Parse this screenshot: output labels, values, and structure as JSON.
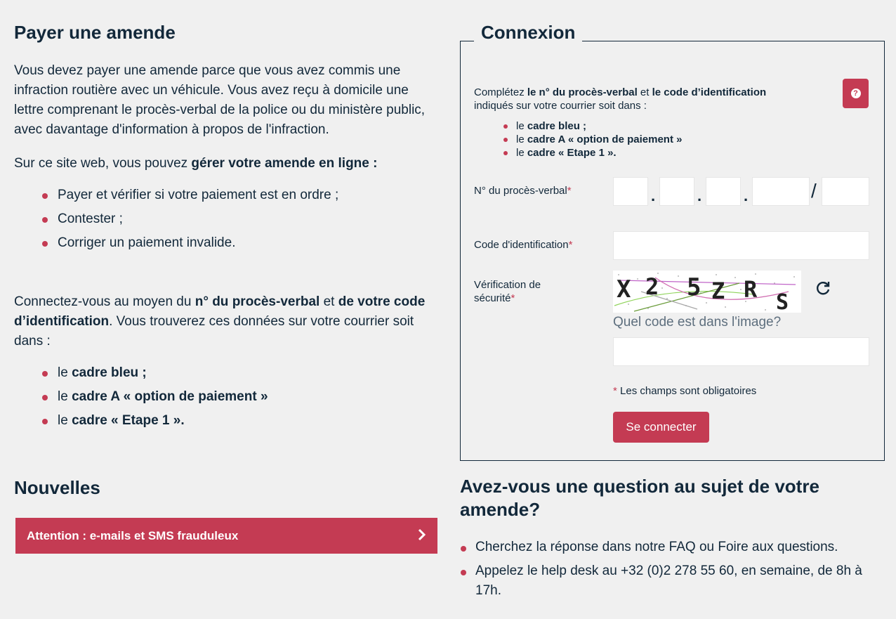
{
  "left": {
    "heading": "Payer une amende",
    "intro": "Vous devez payer une amende parce que vous avez commis une infraction routière avec un véhicule. Vous avez reçu à domicile une lettre comprenant le procès-verbal de la police ou du ministère public, avec davantage d'information à propos de l'infraction.",
    "site_prefix": "Sur ce site web, vous pouvez ",
    "site_bold": "gérer votre amende en ligne :",
    "actions": [
      "Payer et vérifier si votre paiement est en ordre ;",
      "Contester ;",
      "Corriger un paiement invalide."
    ],
    "connect": {
      "t1": "Connectez-vous au moyen du ",
      "b1": "n° du procès-verbal",
      "t2": " et ",
      "b2": "de votre code d’identification",
      "t3": ". Vous trouverez ces données sur votre courrier soit dans :"
    },
    "frames": [
      {
        "pre": "le ",
        "bold": "cadre bleu ;"
      },
      {
        "pre": "le ",
        "bold": "cadre A « option de paiement »"
      },
      {
        "pre": "le ",
        "bold": "cadre « Etape 1 »."
      }
    ]
  },
  "news": {
    "heading": "Nouvelles",
    "item": "Attention : e-mails et SMS frauduleux",
    "icon": "chevron-right-icon"
  },
  "login": {
    "legend": "Connexion",
    "help": {
      "t1": "Complétez ",
      "b1": "le n° du procès-verbal",
      "t2": " et ",
      "b2": "le code d’identification",
      "t3": " indiqués sur votre courrier soit dans :",
      "button_icon": "question-circle-icon"
    },
    "frames": [
      {
        "pre": "le ",
        "bold": "cadre bleu ;"
      },
      {
        "pre": "le ",
        "bold": "cadre A « option de paiement »"
      },
      {
        "pre": "le ",
        "bold": "cadre « Etape 1 »."
      }
    ],
    "pv_label": "N° du procès-verbal",
    "pv_separators": [
      ".",
      ".",
      ".",
      "/"
    ],
    "code_label": "Code d'identification",
    "security_label": "Vérification de sécurité",
    "required_mark": "*",
    "captcha_text": "X2 5ZRS",
    "refresh_icon": "refresh-icon",
    "captcha_question": "Quel code est dans l'image?",
    "required_note": " Les champs sont obligatoires",
    "submit": "Se connecter"
  },
  "question": {
    "heading": "Avez-vous une question au sujet de votre amende?",
    "items": [
      "Cherchez la réponse dans notre FAQ ou Foire aux questions.",
      "Appelez le help desk au +32 (0)2 278 55 60, en semaine, de 8h à 17h."
    ]
  },
  "colors": {
    "accent": "#c43b53",
    "text": "#12283a",
    "background": "#f0f0f0"
  }
}
